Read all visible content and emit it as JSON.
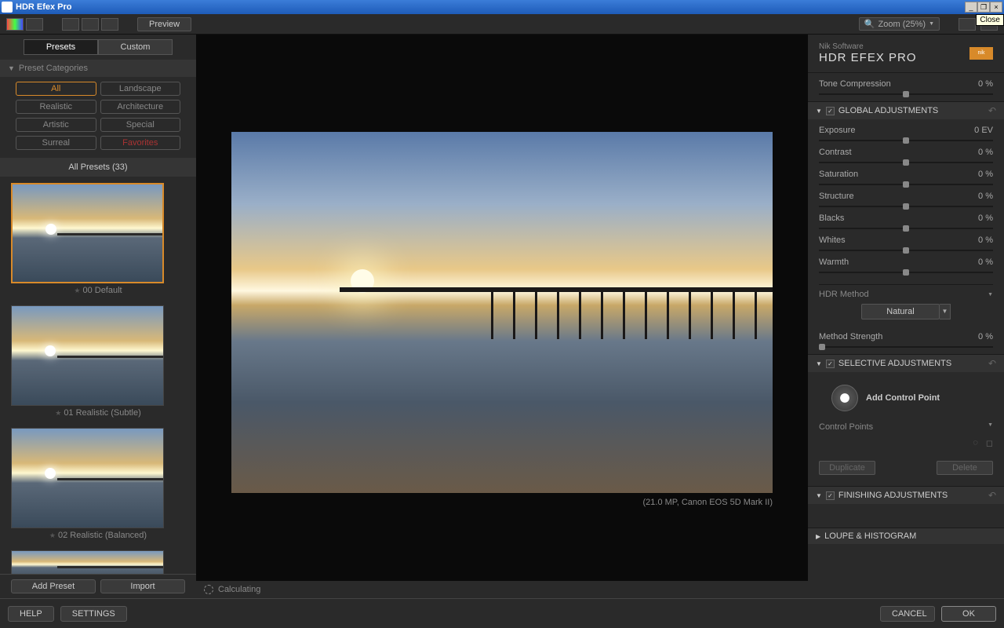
{
  "window": {
    "title": "HDR Efex Pro",
    "close_tooltip": "Close"
  },
  "toolbar": {
    "preview": "Preview",
    "zoom_label": "Zoom (25%)"
  },
  "leftPanel": {
    "tabs": {
      "presets": "Presets",
      "custom": "Custom"
    },
    "categoriesHeader": "Preset Categories",
    "categories": {
      "all": "All",
      "landscape": "Landscape",
      "realistic": "Realistic",
      "architecture": "Architecture",
      "artistic": "Artistic",
      "special": "Special",
      "surreal": "Surreal",
      "favorites": "Favorites"
    },
    "listHeader": "All Presets (33)",
    "presets": [
      {
        "label": "00 Default"
      },
      {
        "label": "01 Realistic (Subtle)"
      },
      {
        "label": "02 Realistic (Balanced)"
      }
    ],
    "addPreset": "Add Preset",
    "import": "Import"
  },
  "center": {
    "meta": "(21.0 MP, Canon EOS 5D Mark II)",
    "status": "Calculating"
  },
  "rightPanel": {
    "brand_small": "Nik Software",
    "brand_big": "HDR EFEX PRO",
    "toneCompression": {
      "label": "Tone Compression",
      "value": "0 %"
    },
    "sections": {
      "global": "GLOBAL ADJUSTMENTS",
      "selective": "SELECTIVE ADJUSTMENTS",
      "finishing": "FINISHING ADJUSTMENTS",
      "loupe": "LOUPE & HISTOGRAM"
    },
    "sliders": {
      "exposure": {
        "label": "Exposure",
        "value": "0 EV"
      },
      "contrast": {
        "label": "Contrast",
        "value": "0 %"
      },
      "saturation": {
        "label": "Saturation",
        "value": "0 %"
      },
      "structure": {
        "label": "Structure",
        "value": "0 %"
      },
      "blacks": {
        "label": "Blacks",
        "value": "0 %"
      },
      "whites": {
        "label": "Whites",
        "value": "0 %"
      },
      "warmth": {
        "label": "Warmth",
        "value": "0 %"
      },
      "methodStrength": {
        "label": "Method Strength",
        "value": "0 %"
      }
    },
    "hdrMethod": {
      "label": "HDR Method",
      "value": "Natural"
    },
    "addControlPoint": "Add Control Point",
    "controlPointsLabel": "Control Points",
    "duplicate": "Duplicate",
    "delete": "Delete"
  },
  "bottom": {
    "help": "HELP",
    "settings": "SETTINGS",
    "cancel": "CANCEL",
    "ok": "OK"
  }
}
